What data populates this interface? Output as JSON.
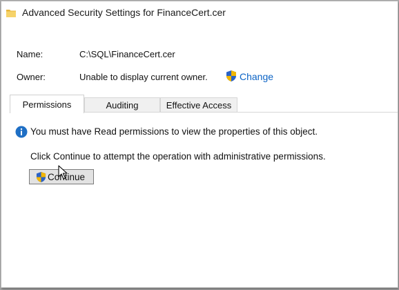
{
  "window": {
    "title": "Advanced Security Settings for FinanceCert.cer",
    "title_icon": "folder-icon"
  },
  "fields": {
    "name_label": "Name:",
    "name_value": "C:\\SQL\\FinanceCert.cer",
    "owner_label": "Owner:",
    "owner_value": "Unable to display current owner.",
    "change_link": "Change"
  },
  "tabs": [
    {
      "label": "Permissions",
      "active": true
    },
    {
      "label": "Auditing",
      "active": false
    },
    {
      "label": "Effective Access",
      "active": false
    }
  ],
  "messages": {
    "info": "You must have Read permissions to view the properties of this object.",
    "instruction": "Click Continue to attempt the operation with administrative permissions."
  },
  "buttons": {
    "continue": "Continue"
  },
  "colors": {
    "link": "#0b63c5",
    "info_icon": "#1f6fc5",
    "shield_blue": "#2b63c6",
    "shield_gold": "#f2b600",
    "folder": "#f3c84e"
  }
}
